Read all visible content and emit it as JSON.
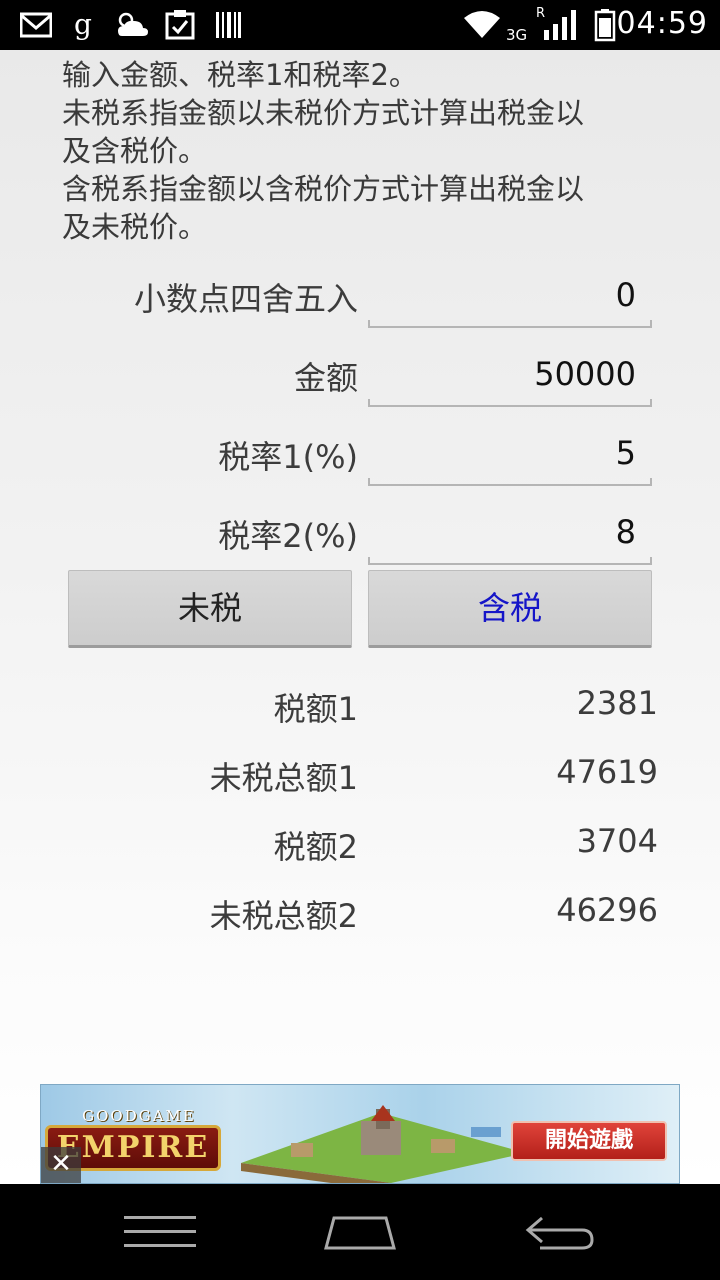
{
  "status_bar": {
    "time": "04:59",
    "network_label": "3G",
    "roaming_label": "R"
  },
  "description": {
    "lines": [
      "输入金额、税率1和税率2。",
      "未税系指金额以未税价方式计算出税金以",
      "及含税价。",
      "含税系指金额以含税价方式计算出税金以",
      "及未税价。"
    ]
  },
  "form": {
    "rounding_label": "小数点四舍五入",
    "rounding_value": "0",
    "amount_label": "金额",
    "amount_value": "50000",
    "rate1_label": "税率1(%)",
    "rate1_value": "5",
    "rate2_label": "税率2(%)",
    "rate2_value": "8"
  },
  "buttons": {
    "untaxed_label": "未税",
    "taxed_label": "含税"
  },
  "results": [
    {
      "label": "税额1",
      "value": "2381"
    },
    {
      "label": "未税总额1",
      "value": "47619"
    },
    {
      "label": "税额2",
      "value": "3704"
    },
    {
      "label": "未税总额2",
      "value": "46296"
    }
  ],
  "ad": {
    "brand_top": "GOODGAME",
    "brand_main": "EMPIRE",
    "cta": "開始遊戲",
    "close_glyph": "✕"
  },
  "colors": {
    "taxed_button_text": "#1515c8",
    "ad_cta": "#c92b22"
  }
}
